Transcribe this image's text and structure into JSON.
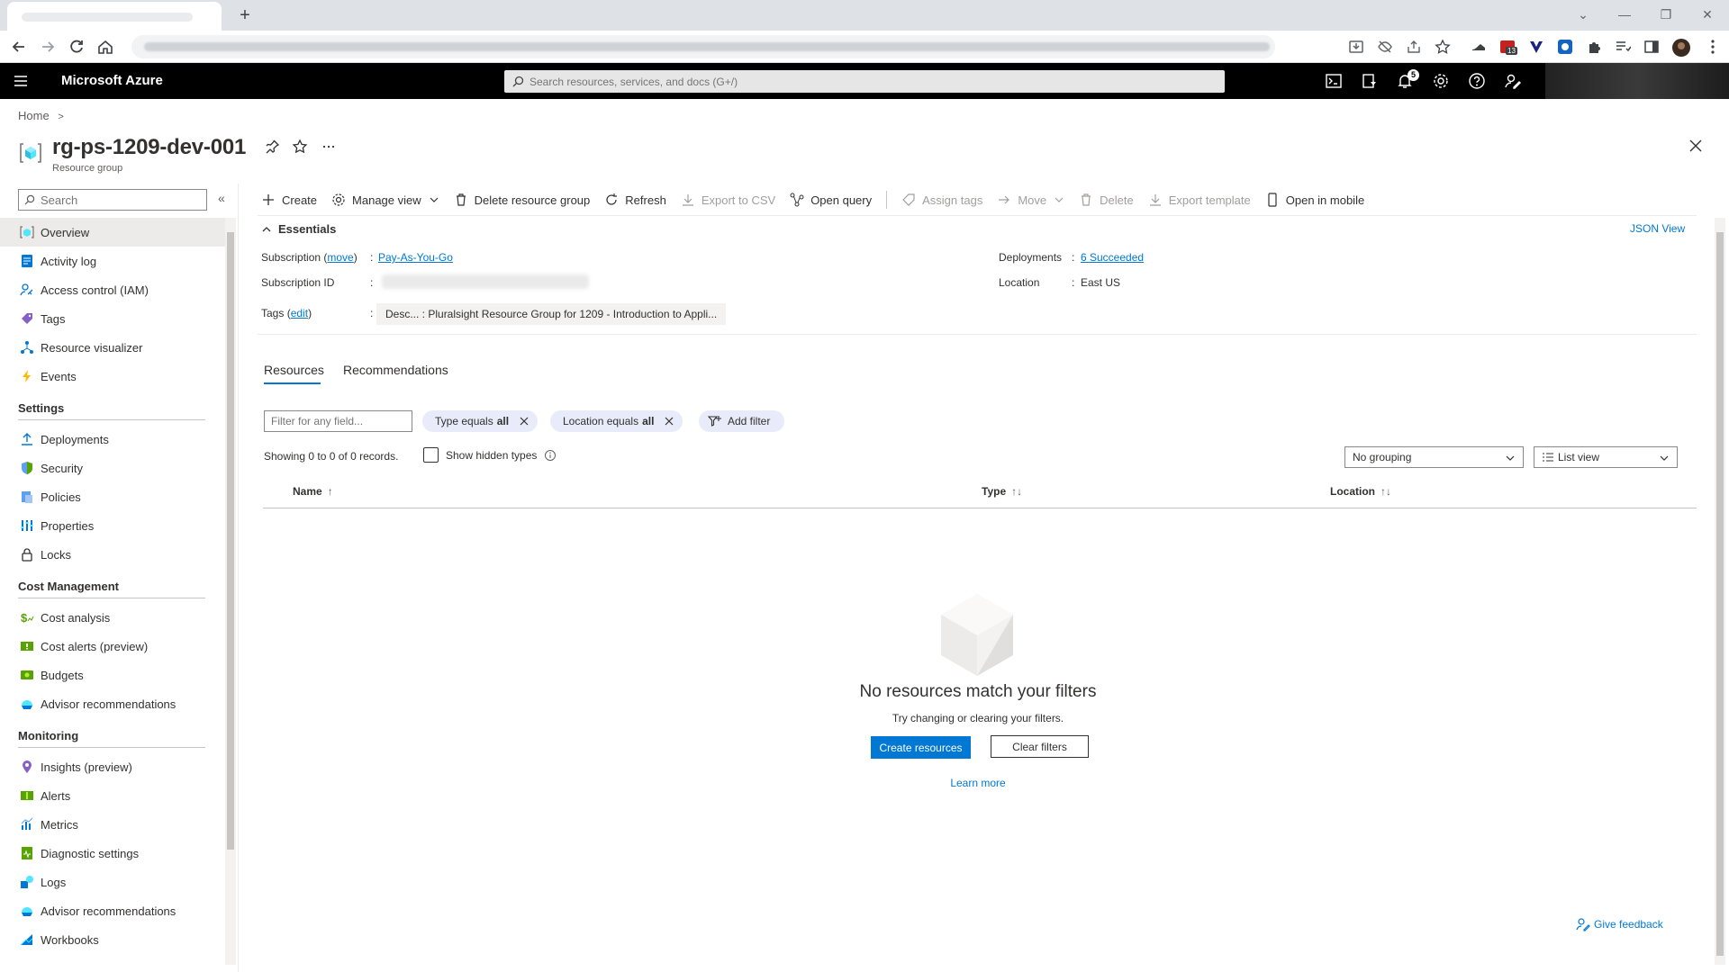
{
  "browser": {
    "new_tab_label": "+",
    "window_controls": [
      "⌄",
      "—",
      "❐",
      "✕"
    ],
    "notification_count": "13"
  },
  "azure": {
    "brand": "Microsoft Azure",
    "search_placeholder": "Search resources, services, and docs (G+/)",
    "notification_badge": "5"
  },
  "breadcrumb": {
    "home": "Home",
    "separator": ">"
  },
  "resource": {
    "title": "rg-ps-1209-dev-001",
    "subtitle": "Resource group"
  },
  "nav": {
    "search_placeholder": "Search",
    "collapse_label": "«",
    "items": [
      {
        "label": "Overview",
        "icon": "overview-icon",
        "selected": true
      },
      {
        "label": "Activity log",
        "icon": "activity-log-icon"
      },
      {
        "label": "Access control (IAM)",
        "icon": "iam-icon"
      },
      {
        "label": "Tags",
        "icon": "tag-icon"
      },
      {
        "label": "Resource visualizer",
        "icon": "visualizer-icon"
      },
      {
        "label": "Events",
        "icon": "lightning-icon"
      }
    ],
    "settings_title": "Settings",
    "settings": [
      {
        "label": "Deployments",
        "icon": "deployments-icon"
      },
      {
        "label": "Security",
        "icon": "shield-icon"
      },
      {
        "label": "Policies",
        "icon": "policies-icon"
      },
      {
        "label": "Properties",
        "icon": "properties-icon"
      },
      {
        "label": "Locks",
        "icon": "lock-icon"
      }
    ],
    "cost_title": "Cost Management",
    "cost": [
      {
        "label": "Cost analysis",
        "icon": "cost-analysis-icon"
      },
      {
        "label": "Cost alerts (preview)",
        "icon": "cost-alerts-icon"
      },
      {
        "label": "Budgets",
        "icon": "budgets-icon"
      },
      {
        "label": "Advisor recommendations",
        "icon": "advisor-icon"
      }
    ],
    "monitoring_title": "Monitoring",
    "monitoring": [
      {
        "label": "Insights (preview)",
        "icon": "insights-icon"
      },
      {
        "label": "Alerts",
        "icon": "alerts-icon"
      },
      {
        "label": "Metrics",
        "icon": "metrics-icon"
      },
      {
        "label": "Diagnostic settings",
        "icon": "diagnostic-icon"
      },
      {
        "label": "Logs",
        "icon": "logs-icon"
      },
      {
        "label": "Advisor recommendations",
        "icon": "advisor-icon"
      },
      {
        "label": "Workbooks",
        "icon": "workbooks-icon"
      }
    ]
  },
  "commands": {
    "create": "Create",
    "manage_view": "Manage view",
    "delete_rg": "Delete resource group",
    "refresh": "Refresh",
    "export_csv": "Export to CSV",
    "open_query": "Open query",
    "assign_tags": "Assign tags",
    "move": "Move",
    "delete": "Delete",
    "export_template": "Export template",
    "open_mobile": "Open in mobile"
  },
  "essentials": {
    "title": "Essentials",
    "json_view": "JSON View",
    "subscription_label": "Subscription",
    "move_link": "move",
    "subscription_value": "Pay-As-You-Go",
    "subscription_id_label": "Subscription ID",
    "tags_label": "Tags",
    "edit_link": "edit",
    "tag_value": "Desc... : Pluralsight Resource Group for 1209 - Introduction to Appli...",
    "deployments_label": "Deployments",
    "deployments_value": "6 Succeeded",
    "location_label": "Location",
    "location_value": "East US",
    "colon": ":"
  },
  "tabs": {
    "resources": "Resources",
    "recommendations": "Recommendations"
  },
  "filters": {
    "filter_placeholder": "Filter for any field...",
    "type_pill_prefix": "Type equals",
    "type_pill_value": "all",
    "location_pill_prefix": "Location equals",
    "location_pill_value": "all",
    "add_filter": "Add filter",
    "records": "Showing 0 to 0 of 0 records.",
    "show_hidden": "Show hidden types",
    "grouping": "No grouping",
    "view": "List view"
  },
  "grid": {
    "columns": [
      "Name",
      "Type",
      "Location"
    ],
    "name_sort": "↑",
    "type_sort": "↑↓",
    "location_sort": "↑↓"
  },
  "empty": {
    "title": "No resources match your filters",
    "subtitle": "Try changing or clearing your filters.",
    "create_button": "Create resources",
    "clear_button": "Clear filters",
    "learn_more": "Learn more"
  },
  "feedback": "Give feedback",
  "colors": {
    "accent": "#0078d4",
    "header": "#000000",
    "selected_nav": "#edebe9"
  }
}
